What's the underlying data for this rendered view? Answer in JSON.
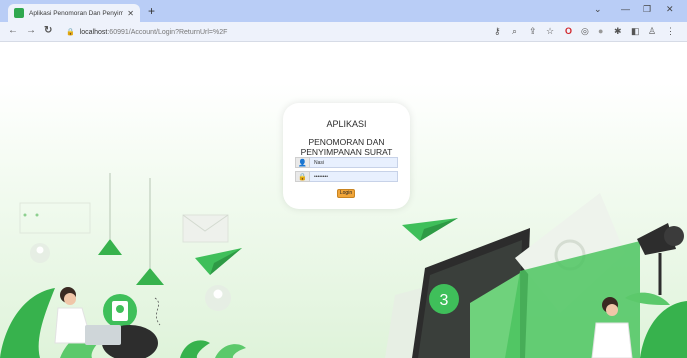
{
  "browser": {
    "tab_title": "Aplikasi Penomoran Dan Penyim...",
    "tab_close": "✕",
    "new_tab": "+",
    "url_host": "localhost",
    "url_rest": ":60991/Account/Login?ReturnUrl=%2F",
    "window_minimize": "—",
    "window_restore": "❐",
    "window_close": "✕",
    "collapse": "⌄"
  },
  "login": {
    "title": "APLIKASI",
    "subtitle_line1": "PENOMORAN DAN",
    "subtitle_line2": "PENYIMPANAN SURAT",
    "username_value": "Nasi",
    "password_value": "••••••••",
    "login_label": "Login"
  },
  "colors": {
    "accent_green": "#3fbf5a",
    "tab_strip": "#b9cdf6",
    "login_button": "#f0a53a"
  }
}
